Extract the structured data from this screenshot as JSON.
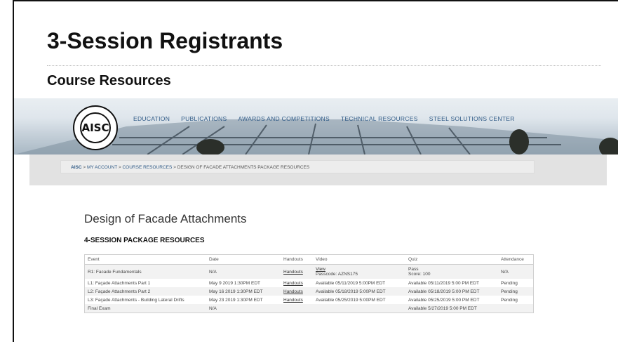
{
  "slide": {
    "title": "3-Session Registrants",
    "subtitle": "Course Resources"
  },
  "site": {
    "logo_text": "AISC",
    "nav": [
      "EDUCATION",
      "PUBLICATIONS",
      "AWARDS AND COMPETITIONS",
      "TECHNICAL RESOURCES",
      "STEEL SOLUTIONS CENTER"
    ]
  },
  "breadcrumb": {
    "home": "AISC",
    "sep": ">",
    "account": "MY ACCOUNT",
    "resources": "COURSE RESOURCES",
    "current": "DESIGN OF FACADE ATTACHMENTS PACKAGE RESOURCES"
  },
  "page": {
    "heading": "Design of Facade Attachments",
    "section": "4-SESSION PACKAGE RESOURCES"
  },
  "table": {
    "headers": [
      "Event",
      "Date",
      "Handouts",
      "Video",
      "Quiz",
      "Attendance"
    ],
    "rows": [
      {
        "event": "R1: Facade Fundamentals",
        "date": "N/A",
        "handouts": "Handouts",
        "video": "View",
        "video_extra": "Passcode: AZNS175",
        "quiz": "Pass",
        "quiz_extra": "Score: 100",
        "attendance": "N/A"
      },
      {
        "event": "L1: Façade Attachments Part 1",
        "date": "May 9 2019 1:30PM EDT",
        "handouts": "Handouts",
        "video": "Available 05/11/2019 5:00PM EDT",
        "quiz": "Available 05/11/2019 5:00 PM EDT",
        "attendance": "Pending"
      },
      {
        "event": "L2: Façade Attachments Part 2",
        "date": "May 16 2019 1:30PM EDT",
        "handouts": "Handouts",
        "video": "Available 05/18/2019 5:00PM EDT",
        "quiz": "Available 05/18/2019 5:00 PM EDT",
        "attendance": "Pending"
      },
      {
        "event": "L3: Façade Attachments - Building Lateral Drifts",
        "date": "May 23 2019 1:30PM EDT",
        "handouts": "Handouts",
        "video": "Available 05/25/2019 5:00PM EDT",
        "quiz": "Available 05/25/2019 5:00 PM EDT",
        "attendance": "Pending"
      },
      {
        "event": "Final Exam",
        "date": "N/A",
        "handouts": "",
        "video": "",
        "quiz": "Available 5/27/2019 5:00 PM EDT",
        "attendance": ""
      }
    ]
  }
}
